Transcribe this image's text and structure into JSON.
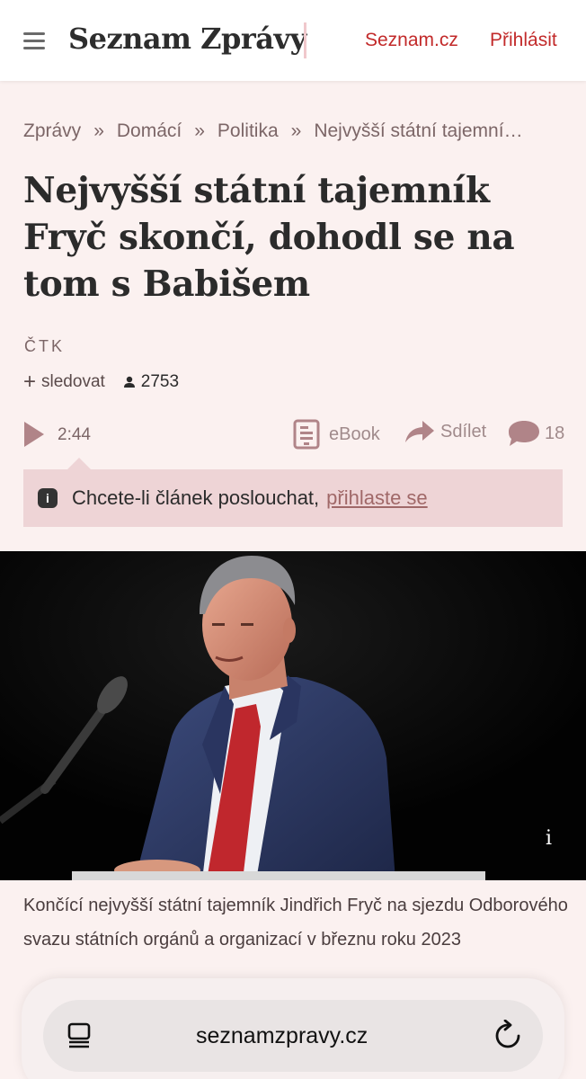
{
  "header": {
    "logo": "Seznam Zprávy",
    "seznam_link": "Seznam.cz",
    "login_link": "Přihlásit",
    "menu_icon": "hamburger-menu-icon"
  },
  "breadcrumb": [
    "Zprávy",
    "Domácí",
    "Politika",
    "Nejvyšší státní tajemník Fryč skončí, dohodl se na tom s Babišem"
  ],
  "breadcrumb_sep": "»",
  "article": {
    "title": "Nejvyšší státní tajemník Fryč skončí, dohodl se na tom s Babišem",
    "source": "ČTK",
    "follow_label": "sledovat",
    "follower_count": "2753",
    "audio_duration": "2:44",
    "ebook_label": "eBook",
    "share_label": "Sdílet",
    "comments_count": "18",
    "notice_text": "Chcete-li článek poslouchat,",
    "notice_link": "přihlaste se",
    "photo_info": "i",
    "caption": "Končící nejvyšší státní tajemník Jindřich Fryč na sjezdu Odborového svazu státních orgánů a organizací v březnu roku 2023"
  },
  "browser": {
    "url": "seznamzpravy.cz"
  },
  "colors": {
    "accent": "#c22a2a",
    "background": "#fbf1f0",
    "notice_bg": "#eed4d6"
  }
}
